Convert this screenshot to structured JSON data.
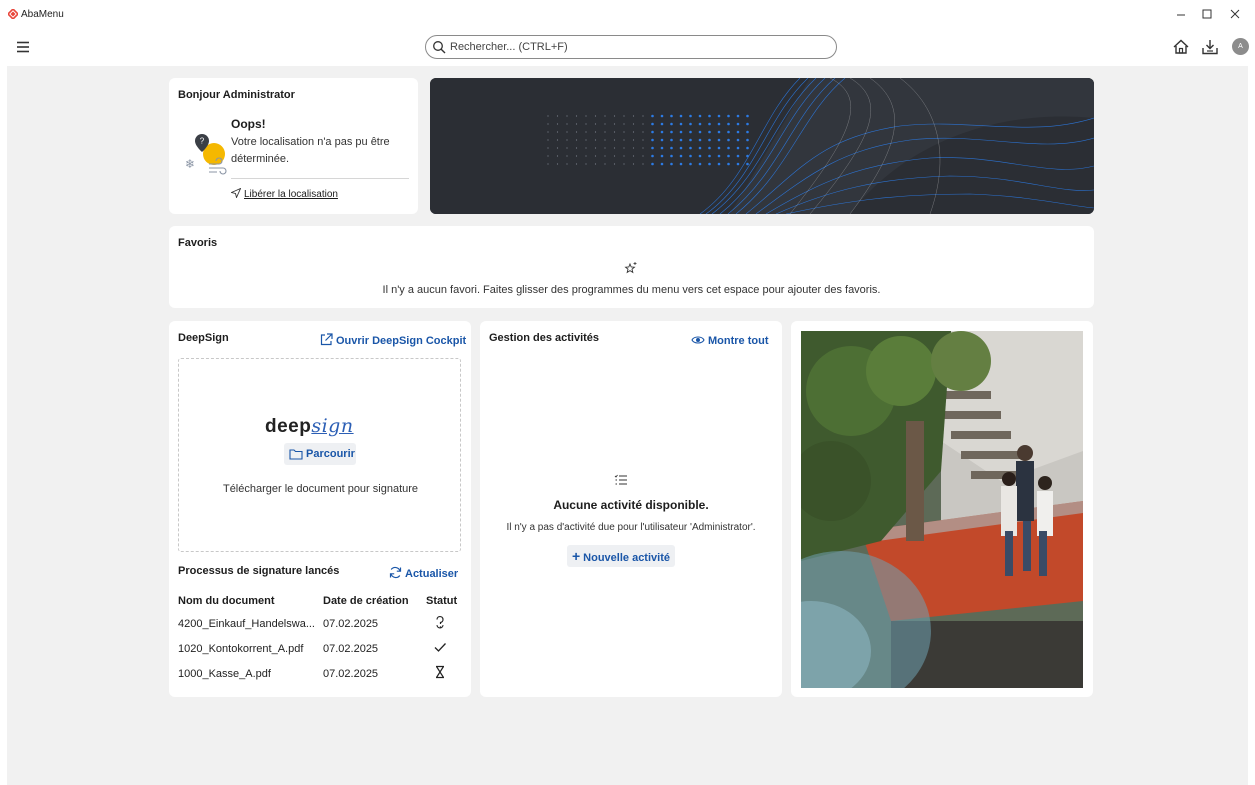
{
  "window": {
    "title": "AbaMenu",
    "brand_color": "#e8473c",
    "minimize_icon": "minimize-icon",
    "maximize_icon": "maximize-icon",
    "close_icon": "close-icon"
  },
  "header": {
    "search_placeholder": "Rechercher... (CTRL+F)",
    "avatar_initial": "A"
  },
  "weather": {
    "greeting": "Bonjour Administrator",
    "error_title": "Oops!",
    "error_message": "Votre localisation n'a pas pu être déterminée.",
    "free_location_label": "Libérer la localisation"
  },
  "favorites": {
    "title": "Favoris",
    "empty_message": "Il n'y a aucun favori. Faites glisser des programmes du menu vers cet espace pour ajouter des favoris."
  },
  "deepsign": {
    "title": "DeepSign",
    "open_cockpit_label": "Ouvrir DeepSign Cockpit",
    "logo_text_plain": "deep",
    "logo_text_script": "sign",
    "browse_label": "Parcourir",
    "upload_hint": "Télécharger le document pour signature",
    "processes_title": "Processus de signature lancés",
    "refresh_label": "Actualiser",
    "columns": [
      "Nom du document",
      "Date de création",
      "Statut"
    ],
    "rows": [
      {
        "name": "4200_Einkauf_Handelswa...",
        "date": "07.02.2025",
        "status_icon": "question-icon"
      },
      {
        "name": "1020_Kontokorrent_A.pdf",
        "date": "07.02.2025",
        "status_icon": "check-icon"
      },
      {
        "name": "1000_Kasse_A.pdf",
        "date": "07.02.2025",
        "status_icon": "hourglass-icon"
      }
    ]
  },
  "activities": {
    "title": "Gestion des activités",
    "show_all_label": "Montre tout",
    "empty_title": "Aucune activité disponible.",
    "empty_message": "Il n'y a pas d'activité due pour l'utilisateur 'Administrator'.",
    "new_activity_label": "Nouvelle activité"
  },
  "colors": {
    "accent": "#1a56a8",
    "banner_bg": "#2a2d33",
    "dot_blue": "#2c7be5"
  }
}
